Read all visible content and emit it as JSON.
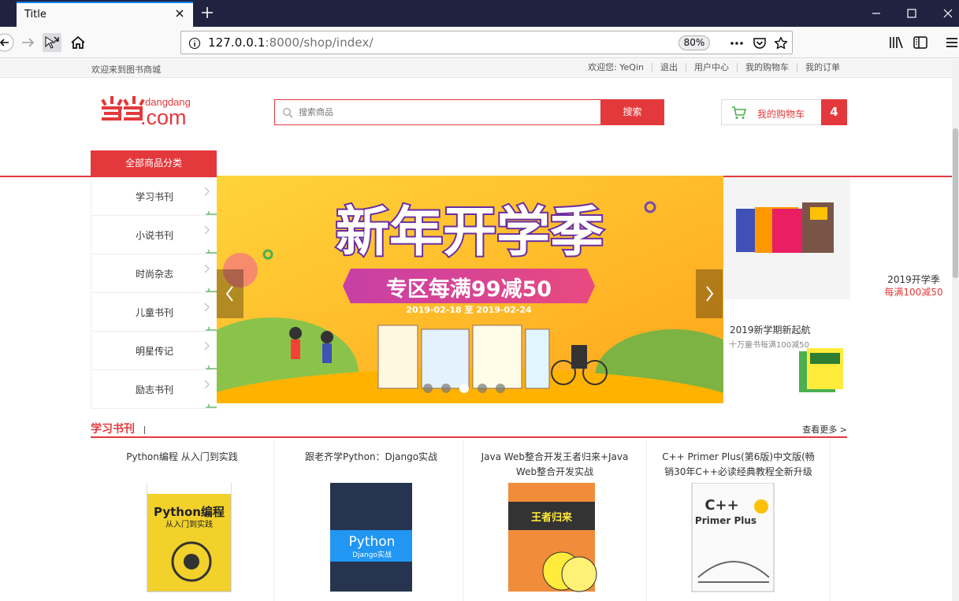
{
  "browser": {
    "tab_title": "Title",
    "url_host": "127.0.0.1",
    "url_rest": ":8000/shop/index/",
    "zoom": "80%"
  },
  "topbar": {
    "welcome": "欢迎来到图书商城",
    "greeting": "欢迎您: YeQin",
    "logout": "退出",
    "user_center": "用户中心",
    "my_cart": "我的购物车",
    "my_orders": "我的订单"
  },
  "header": {
    "logo_sub": "dangdang",
    "logo_main": ".com",
    "search_placeholder": "搜索商品",
    "search_button": "搜索",
    "cart_label": "我的购物车",
    "cart_count": "4"
  },
  "nav": {
    "all_categories": "全部商品分类",
    "categories": [
      "学习书刊",
      "小说书刊",
      "时尚杂志",
      "儿童书刊",
      "明星传记",
      "励志书刊"
    ]
  },
  "banner": {
    "headline": "新年开学季",
    "subline": "专区每满99减50",
    "dates": "2019-02-18 至 2019-02-24",
    "slide_count": 5,
    "active_slide": 3
  },
  "side": {
    "promo1_title": "2019开学季",
    "promo1_red": "每满100减50",
    "promo2_title": "2019新学期新起航",
    "promo2_sub": "十万童书每满100减50"
  },
  "section": {
    "title": "学习书刊",
    "more": "查看更多 >"
  },
  "books": [
    {
      "title": "Python编程 从入门到实践"
    },
    {
      "title": "跟老齐学Python：Django实战"
    },
    {
      "title": "Java Web整合开发王者归来+Java Web整合开发实战"
    },
    {
      "title": "C++ Primer Plus(第6版)中文版(畅销30年C++必读经典教程全新升级"
    }
  ],
  "colors": {
    "accent": "#e4393c",
    "chrome": "#202340"
  }
}
